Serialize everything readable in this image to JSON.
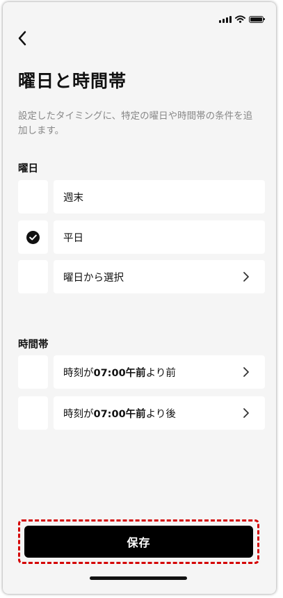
{
  "status_bar": {
    "icons": [
      "signal-icon",
      "wifi-icon",
      "battery-icon"
    ]
  },
  "header": {
    "back_icon": "chevron-left-icon",
    "title": "曜日と時間帯"
  },
  "description": "設定したタイミングに、特定の曜日や時間帯の条件を追加します。",
  "days_section": {
    "label": "曜日",
    "options": [
      {
        "label": "週末",
        "checked": false,
        "has_chevron": false
      },
      {
        "label": "平日",
        "checked": true,
        "has_chevron": false
      },
      {
        "label": "曜日から選択",
        "checked": false,
        "has_chevron": true
      }
    ]
  },
  "time_section": {
    "label": "時間帯",
    "options": [
      {
        "prefix": "時刻が",
        "time": "07:00午前",
        "suffix": "より前",
        "checked": false
      },
      {
        "prefix": "時刻が",
        "time": "07:00午前",
        "suffix": "より後",
        "checked": false
      }
    ]
  },
  "save_button": {
    "label": "保存"
  },
  "colors": {
    "accent": "#000000",
    "background": "#f5f5f5",
    "highlight": "#d40000"
  }
}
